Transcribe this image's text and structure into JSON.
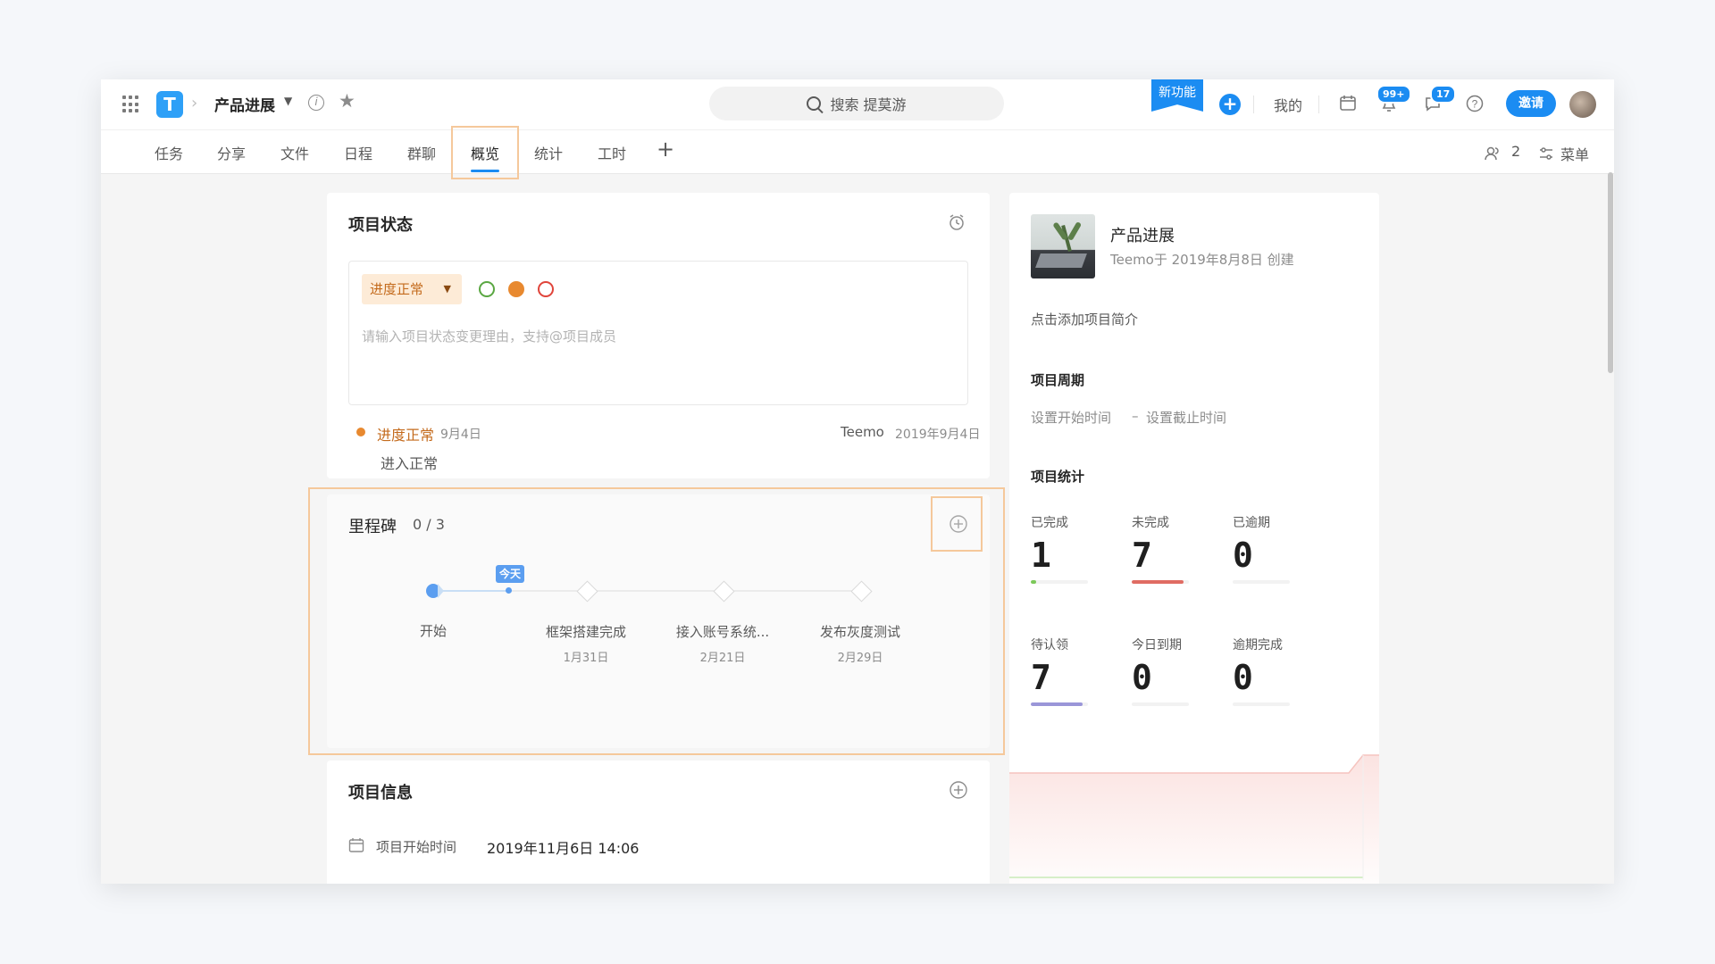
{
  "header": {
    "project_title": "产品进展",
    "search_placeholder": "搜索 提莫游",
    "new_feature": "新功能",
    "mine": "我的",
    "notifications_badge": "99+",
    "messages_badge": "17",
    "invite": "邀请"
  },
  "tabs": [
    {
      "label": "任务"
    },
    {
      "label": "分享"
    },
    {
      "label": "文件"
    },
    {
      "label": "日程"
    },
    {
      "label": "群聊"
    },
    {
      "label": "概览",
      "active": true
    },
    {
      "label": "统计"
    },
    {
      "label": "工时"
    }
  ],
  "toolbar": {
    "members_count": "2",
    "menu": "菜单"
  },
  "project_status": {
    "title": "项目状态",
    "selected": "进度正常",
    "placeholder": "请输入项目状态变更理由，支持@项目成员",
    "status_colors": [
      "#5aa742",
      "#e8892f",
      "#e0443a"
    ],
    "log": {
      "status": "进度正常",
      "date": "9月4日",
      "author": "Teemo",
      "timestamp": "2019年9月4日",
      "note": "进入正常"
    }
  },
  "milestones": {
    "title": "里程碑",
    "count": "0 / 3",
    "today": "今天",
    "items": [
      {
        "label": "开始",
        "date": ""
      },
      {
        "label": "框架搭建完成",
        "date": "1月31日"
      },
      {
        "label": "接入账号系统...",
        "date": "2月21日"
      },
      {
        "label": "发布灰度测试",
        "date": "2月29日"
      }
    ]
  },
  "project_info": {
    "title": "项目信息",
    "start_label": "项目开始时间",
    "start_value": "2019年11月6日 14:06"
  },
  "sidebar": {
    "name": "产品进展",
    "created": "Teemo于 2019年8月8日 创建",
    "add_intro": "点击添加项目简介",
    "period_title": "项目周期",
    "period_start": "设置开始时间",
    "period_dash": "–",
    "period_end": "设置截止时间",
    "stats_title": "项目统计",
    "stats": [
      {
        "label": "已完成",
        "value": "1",
        "color": "#7cc95a",
        "fill": 0.1
      },
      {
        "label": "未完成",
        "value": "7",
        "color": "#e06c63",
        "fill": 0.9
      },
      {
        "label": "已逾期",
        "value": "0",
        "color": "#e06c63",
        "fill": 0
      },
      {
        "label": "待认领",
        "value": "7",
        "color": "#9a96d8",
        "fill": 0.9
      },
      {
        "label": "今日到期",
        "value": "0",
        "color": "#e8c38a",
        "fill": 0
      },
      {
        "label": "逾期完成",
        "value": "0",
        "color": "#e06c63",
        "fill": 0
      }
    ]
  }
}
